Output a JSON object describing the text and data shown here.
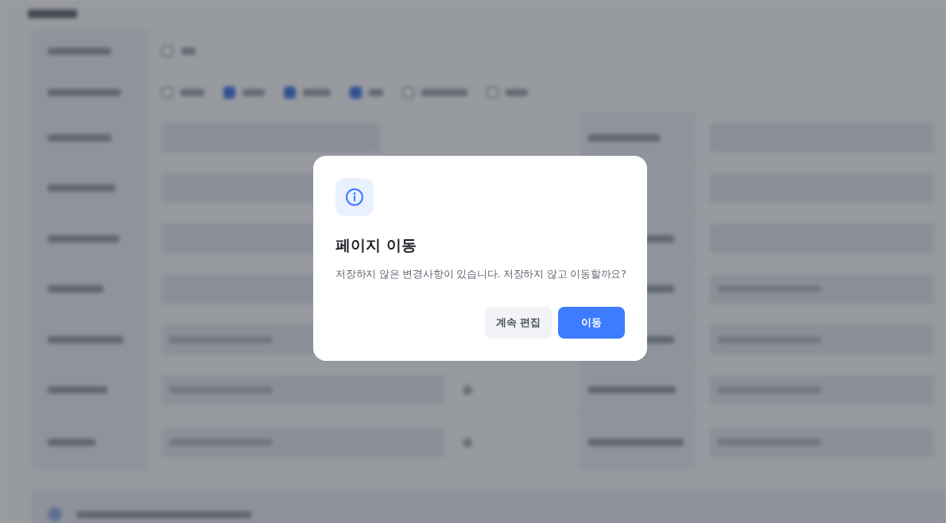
{
  "background": {
    "use_option": {
      "checked": false
    },
    "sns_options": [
      {
        "checked": false
      },
      {
        "checked": true
      },
      {
        "checked": true
      },
      {
        "checked": true
      },
      {
        "checked": false
      },
      {
        "checked": false
      }
    ]
  },
  "dialog": {
    "title": "페이지 이동",
    "message": "저장하지 않은 변경사항이 있습니다. 저장하지 않고 이동할까요?",
    "buttons": [
      {
        "label": "계속 편집",
        "kind": "secondary"
      },
      {
        "label": "이동",
        "kind": "primary"
      }
    ]
  }
}
